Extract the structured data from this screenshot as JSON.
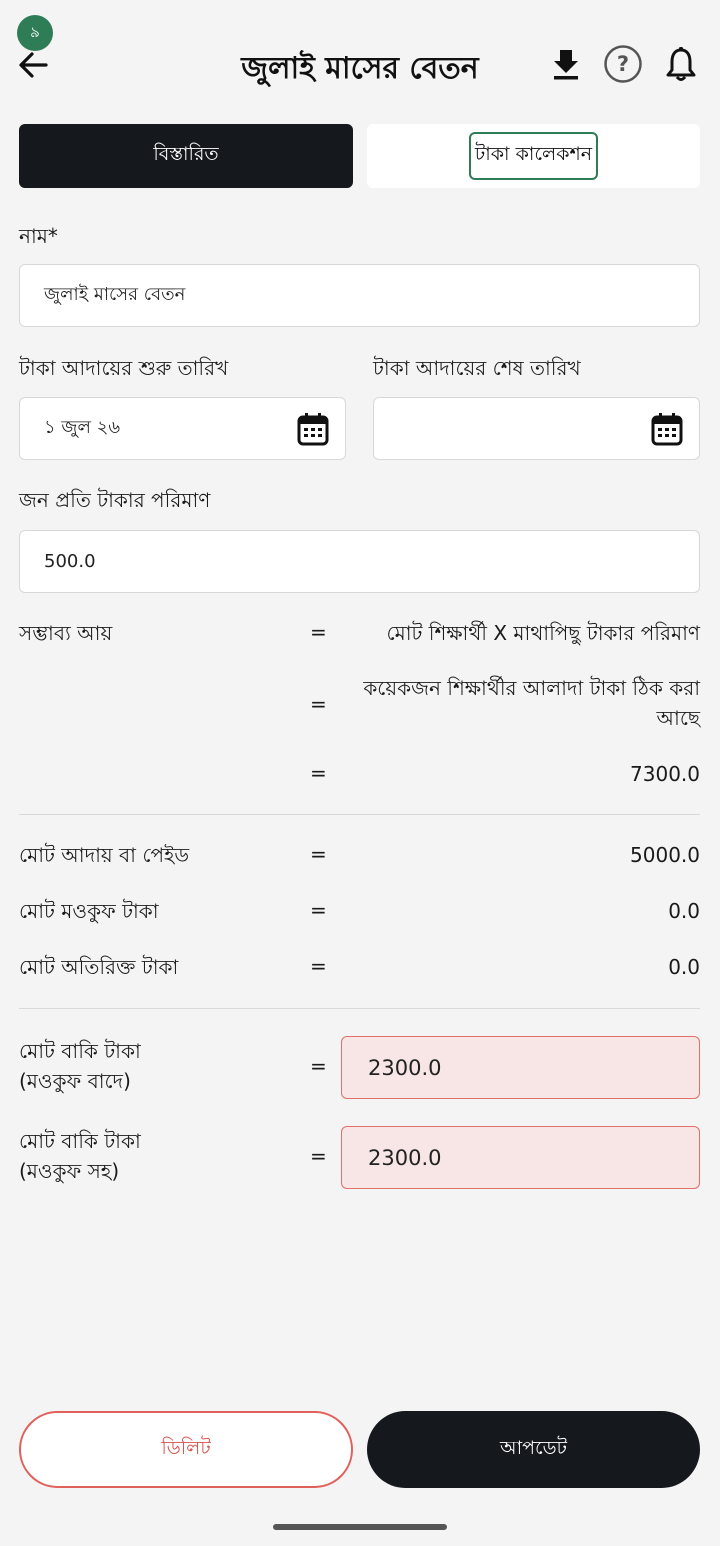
{
  "status": {
    "badge": "৯"
  },
  "header": {
    "title": "জুলাই মাসের বেতন",
    "icons": [
      "back-arrow-icon",
      "download-icon",
      "help-icon",
      "bell-icon"
    ],
    "help_glyph": "?"
  },
  "tabs": [
    {
      "label": "বিস্তারিত",
      "active": true
    },
    {
      "label": "টাকা কালেকশন",
      "active": false
    }
  ],
  "form": {
    "name_label": "নাম*",
    "name_value": "জুলাই মাসের বেতন",
    "start_date_label": "টাকা আদায়ের শুরু তারিখ",
    "start_date_value": "১ জুল ২৬",
    "end_date_label": "টাকা আদায়ের শেষ তারিখ",
    "end_date_value": "",
    "amount_label": "জন প্রতি টাকার পরিমাণ",
    "amount_value": "500.0"
  },
  "summary": {
    "eq": "=",
    "possible_income_label": "সম্ভাব্য আয়",
    "formula_line1": "মোট শিক্ষার্থী X মাথাপিছু টাকার পরিমাণ",
    "formula_line2": "কয়েকজন শিক্ষার্থীর আলাদা টাকা ঠিক করা আছে",
    "possible_income_value": "7300.0",
    "total_paid_label": "মোট আদায় বা পেইড",
    "total_paid_value": "5000.0",
    "total_waived_label": "মোট মওকুফ টাকা",
    "total_waived_value": "0.0",
    "total_extra_label": "মোট অতিরিক্ত টাকা",
    "total_extra_value": "0.0",
    "due_excl_label_1": "মোট বাকি টাকা",
    "due_excl_label_2": "(মওকুফ বাদে)",
    "due_excl_value": "2300.0",
    "due_incl_label_1": "মোট বাকি টাকা",
    "due_incl_label_2": "(মওকুফ সহ)",
    "due_incl_value": "2300.0"
  },
  "actions": {
    "delete_label": "ডিলিট",
    "update_label": "আপডেট"
  },
  "colors": {
    "accent_green": "#2e7d57",
    "danger": "#e0605a",
    "dark": "#15181c"
  }
}
